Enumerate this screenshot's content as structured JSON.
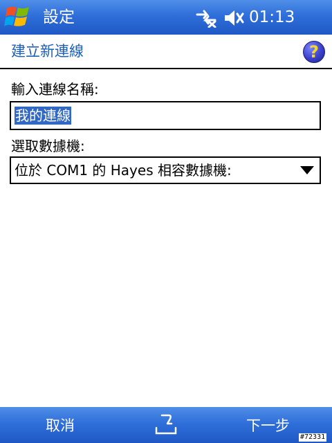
{
  "titlebar": {
    "title": "設定",
    "clock": "01:13",
    "icons": [
      "windows-start-icon",
      "connectivity-icon",
      "volume-muted-icon"
    ]
  },
  "page": {
    "title": "建立新連線",
    "help_icon": "help-icon",
    "help_label": "?"
  },
  "form": {
    "name_label": "輸入連線名稱:",
    "name_value": "我的連線",
    "modem_label": "選取數據機:",
    "modem_value": "位於 COM1 的 Hayes 相容數據機:"
  },
  "softkeys": {
    "left": "取消",
    "right": "下一步",
    "center_icon": "input-panel-icon"
  },
  "watermark": "#72331",
  "colors": {
    "bar_blue": "#2f6fd9",
    "title_blue": "#1e5fb8",
    "selection": "#3168c6"
  }
}
